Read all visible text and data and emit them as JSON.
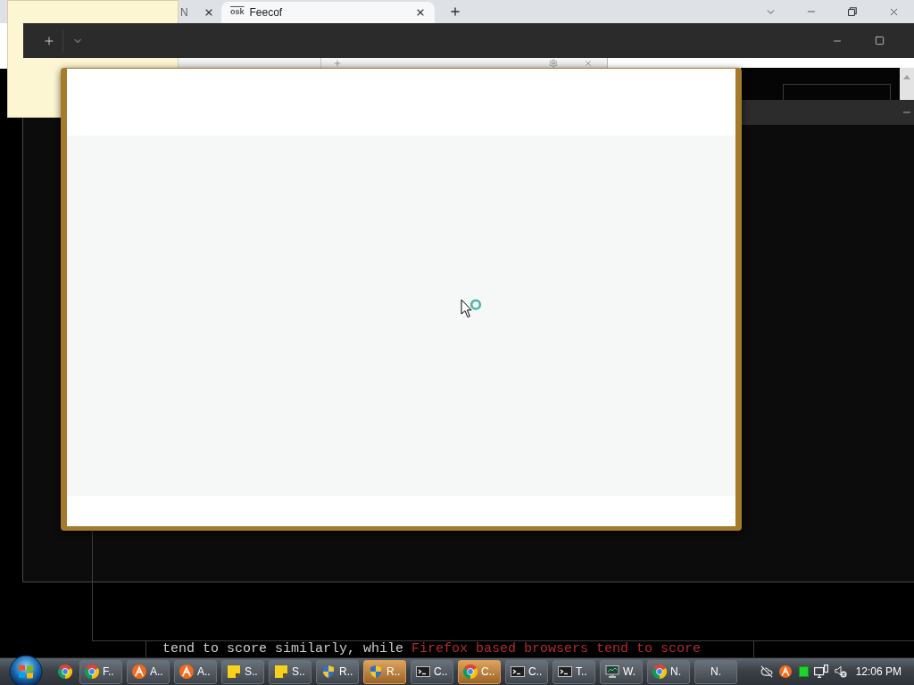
{
  "browser": {
    "tabs": [
      {
        "label": "N",
        "selected": false
      },
      {
        "favicon": "osk",
        "label": "Feecof",
        "selected": true
      }
    ]
  },
  "console": {
    "segments": [
      {
        "text": "tend to score similarly, while",
        "color": "#cccccc"
      },
      {
        "text": "Firefox based browsers tend to score",
        "color": "#b02a2e"
      }
    ]
  },
  "taskbar": {
    "buttons": [
      {
        "kind": "browser",
        "label": "F..",
        "attention": false
      },
      {
        "kind": "logo",
        "label": "A..",
        "attention": false
      },
      {
        "kind": "logo",
        "label": "A..",
        "attention": false
      },
      {
        "kind": "note",
        "label": "S..",
        "attention": false
      },
      {
        "kind": "note",
        "label": "S..",
        "attention": false
      },
      {
        "kind": "shield",
        "label": "R..",
        "attention": false
      },
      {
        "kind": "shield",
        "label": "R..",
        "attention": true
      },
      {
        "kind": "console",
        "label": "C..",
        "attention": false
      },
      {
        "kind": "browser",
        "label": "C..",
        "attention": true
      },
      {
        "kind": "console",
        "label": "C..",
        "attention": false
      },
      {
        "kind": "console",
        "label": "T..",
        "attention": false
      },
      {
        "kind": "monitor",
        "label": "W.",
        "attention": false
      },
      {
        "kind": "browser",
        "label": "N.",
        "attention": false
      },
      {
        "kind": "blank",
        "label": "N.",
        "attention": false
      }
    ],
    "tray": {
      "clock": "12:06 PM"
    }
  }
}
